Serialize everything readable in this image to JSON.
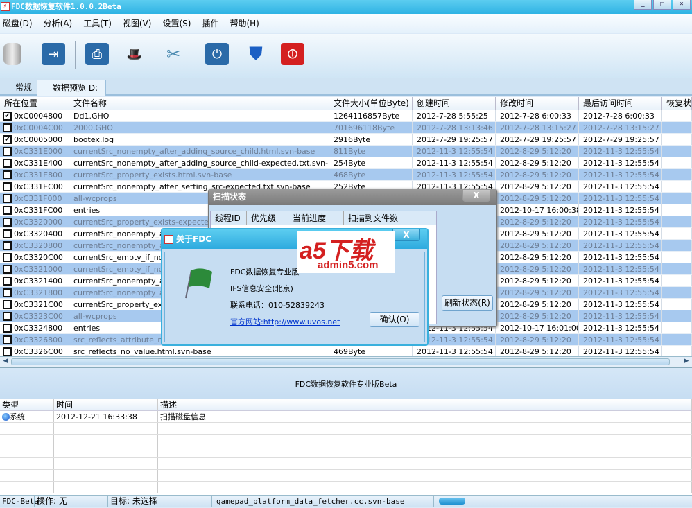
{
  "window": {
    "title": "FDC数据恢复软件1.0.0.2Beta",
    "buttons": [
      "_",
      "□",
      "×"
    ]
  },
  "menu": [
    "磁盘(D)",
    "分析(A)",
    "工具(T)",
    "视图(V)",
    "设置(S)",
    "插件",
    "帮助(H)"
  ],
  "toolbar": [
    "database-icon",
    "arrow-right-icon",
    "scanner-icon",
    "magic-hat-icon",
    "scissors-icon",
    "power-icon",
    "shield-icon",
    "stop-icon"
  ],
  "tabs": [
    {
      "label": "常规"
    },
    {
      "label": "数据预览 D:"
    }
  ],
  "grid": {
    "columns": [
      "所在位置",
      "文件名称",
      "文件大小(单位Byte)",
      "创建时间",
      "修改时间",
      "最后访问时间",
      "恢复状态"
    ],
    "rows": [
      {
        "checked": true,
        "loc": "0xC0004800",
        "name": "Dd1.GHO",
        "size": "1264116857Byte",
        "created": "2012-7-28 5:55:25",
        "modified": "2012-7-28 6:00:33",
        "accessed": "2012-7-28 6:00:33"
      },
      {
        "checked": false,
        "loc": "0xC0004C00",
        "name": "2000.GHO",
        "size": "701696118Byte",
        "created": "2012-7-28 13:13:46",
        "modified": "2012-7-28 13:15:27",
        "accessed": "2012-7-28 13:15:27"
      },
      {
        "checked": true,
        "loc": "0xC0005000",
        "name": "bootex.log",
        "size": "2916Byte",
        "created": "2012-7-29 19:25:57",
        "modified": "2012-7-29 19:25:57",
        "accessed": "2012-7-29 19:25:57"
      },
      {
        "checked": false,
        "loc": "0xC331E000",
        "name": "currentSrc_nonempty_after_adding_source_child.html.svn-base",
        "size": "811Byte",
        "created": "2012-11-3 12:55:54",
        "modified": "2012-8-29 5:12:20",
        "accessed": "2012-11-3 12:55:54"
      },
      {
        "checked": false,
        "loc": "0xC331E400",
        "name": "currentSrc_nonempty_after_adding_source_child-expected.txt.svn-base",
        "size": "254Byte",
        "created": "2012-11-3 12:55:54",
        "modified": "2012-8-29 5:12:20",
        "accessed": "2012-11-3 12:55:54"
      },
      {
        "checked": false,
        "loc": "0xC331E800",
        "name": "currentSrc_property_exists.html.svn-base",
        "size": "468Byte",
        "created": "2012-11-3 12:55:54",
        "modified": "2012-8-29 5:12:20",
        "accessed": "2012-11-3 12:55:54"
      },
      {
        "checked": false,
        "loc": "0xC331EC00",
        "name": "currentSrc_nonempty_after_setting_src-expected.txt.svn-base",
        "size": "252Byte",
        "created": "2012-11-3 12:55:54",
        "modified": "2012-8-29 5:12:20",
        "accessed": "2012-11-3 12:55:54"
      },
      {
        "checked": false,
        "loc": "0xC331F000",
        "name": "all-wcprops",
        "size": "",
        "created": "",
        "modified": "2012-8-29 5:12:20",
        "accessed": "2012-11-3 12:55:54"
      },
      {
        "checked": false,
        "loc": "0xC331FC00",
        "name": "entries",
        "size": "",
        "created": "",
        "modified": "2012-10-17 16:00:38",
        "accessed": "2012-11-3 12:55:54"
      },
      {
        "checked": false,
        "loc": "0xC3320000",
        "name": "currentSrc_property_exists-expected.tx",
        "size": "",
        "created": "",
        "modified": "2012-8-29 5:12:20",
        "accessed": "2012-11-3 12:55:54"
      },
      {
        "checked": false,
        "loc": "0xC3320400",
        "name": "currentSrc_nonempty_aft",
        "size": "",
        "created": "",
        "modified": "2012-8-29 5:12:20",
        "accessed": "2012-11-3 12:55:54"
      },
      {
        "checked": false,
        "loc": "0xC3320800",
        "name": "currentSrc_nonempty_aft",
        "size": "",
        "created": "",
        "modified": "2012-8-29 5:12:20",
        "accessed": "2012-11-3 12:55:54"
      },
      {
        "checked": false,
        "loc": "0xC3320C00",
        "name": "currentSrc_empty_if_no_s",
        "size": "",
        "created": "",
        "modified": "2012-8-29 5:12:20",
        "accessed": "2012-11-3 12:55:54"
      },
      {
        "checked": false,
        "loc": "0xC3321000",
        "name": "currentSrc_empty_if_no_s",
        "size": "",
        "created": "",
        "modified": "2012-8-29 5:12:20",
        "accessed": "2012-11-3 12:55:54"
      },
      {
        "checked": false,
        "loc": "0xC3321400",
        "name": "currentSrc_nonempty_aft",
        "size": "",
        "created": "",
        "modified": "2012-8-29 5:12:20",
        "accessed": "2012-11-3 12:55:54"
      },
      {
        "checked": false,
        "loc": "0xC3321800",
        "name": "currentSrc_nonempty_aft",
        "size": "",
        "created": "",
        "modified": "2012-8-29 5:12:20",
        "accessed": "2012-11-3 12:55:54"
      },
      {
        "checked": false,
        "loc": "0xC3321C00",
        "name": "currentSrc_property_exist",
        "size": "",
        "created": "",
        "modified": "2012-8-29 5:12:20",
        "accessed": "2012-11-3 12:55:54"
      },
      {
        "checked": false,
        "loc": "0xC3323C00",
        "name": "all-wcprops",
        "size": "",
        "created": "",
        "modified": "2012-8-29 5:12:20",
        "accessed": "2012-11-3 12:55:54"
      },
      {
        "checked": false,
        "loc": "0xC3324800",
        "name": "entries",
        "size": "",
        "created": "2012-11-3 12:55:54",
        "modified": "2012-10-17 16:01:00",
        "accessed": "2012-11-3 12:55:54"
      },
      {
        "checked": false,
        "loc": "0xC3326800",
        "name": "src_reflects_attribute_not",
        "size": "",
        "created": "2012-11-3 12:55:54",
        "modified": "2012-8-29 5:12:20",
        "accessed": "2012-11-3 12:55:54"
      },
      {
        "checked": false,
        "loc": "0xC3326C00",
        "name": "src_reflects_no_value.html.svn-base",
        "size": "469Byte",
        "created": "2012-11-3 12:55:54",
        "modified": "2012-8-29 5:12:20",
        "accessed": "2012-11-3 12:55:54"
      }
    ]
  },
  "info_text": "FDC数据恢复软件专业版Beta",
  "log": {
    "columns": [
      "类型",
      "时间",
      "描述"
    ],
    "rows": [
      {
        "type": "系统",
        "time": "2012-12-21 16:33:38",
        "desc": "扫描磁盘信息"
      }
    ]
  },
  "status": {
    "app": "FDC-Beta",
    "operation": "操作: 无",
    "target": "目标: 未选择",
    "file": "gamepad_platform_data_fetcher.cc.svn-base",
    "progress": 0.5
  },
  "scan_dialog": {
    "title": "扫描状态",
    "close": "X",
    "columns": [
      "线程ID",
      "优先级",
      "当前进度",
      "扫描到文件数"
    ],
    "refresh": "刷新状态(R)"
  },
  "about_dialog": {
    "title": "关于FDC",
    "close": "X",
    "product": "FDC数据恢复专业版",
    "company": "IFS信息安全(北京)",
    "phone": "联系电话：010-52839243",
    "website": "官方网站:http://www.uvos.net",
    "ok": "确认(O)"
  },
  "watermark": {
    "big": "a5下载",
    "small": "admin5.com"
  }
}
